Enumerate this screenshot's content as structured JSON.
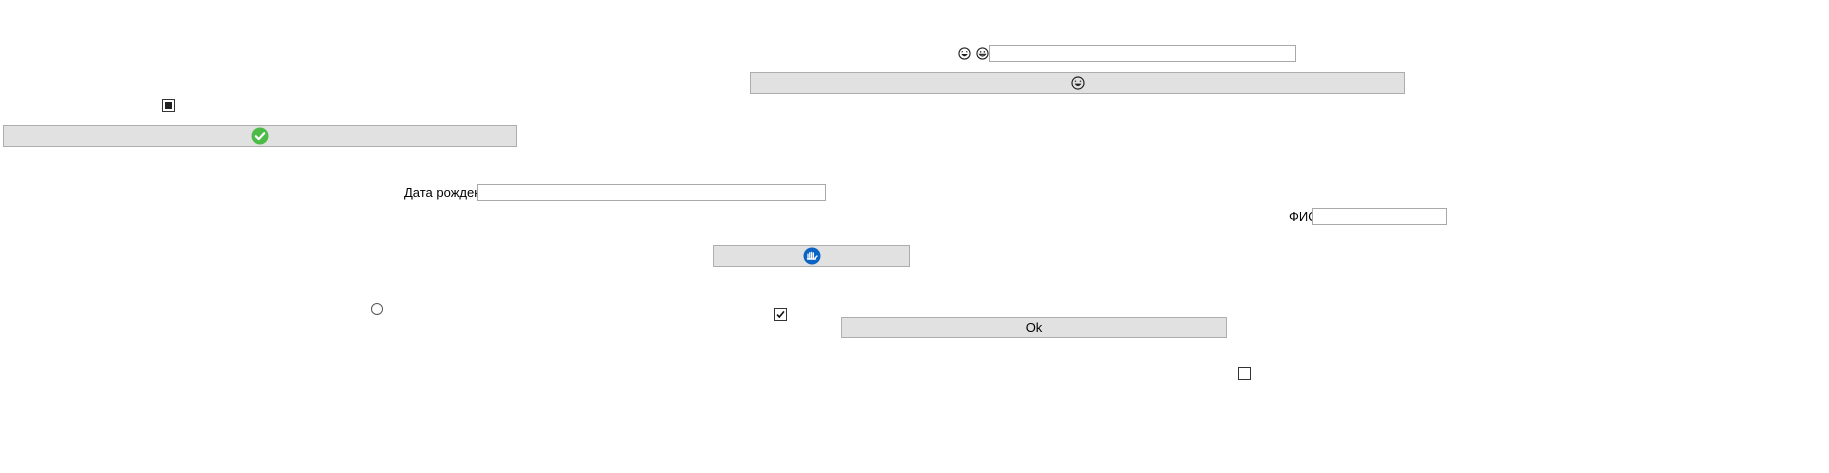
{
  "form": {
    "emoji_field": {
      "icons": [
        "laughing-face-icon",
        "grinning-face-icon"
      ],
      "value": ""
    },
    "emoji_button": {
      "icon": "laughing-face-icon",
      "label": ""
    },
    "square_checkbox": {
      "state": "indeterminate"
    },
    "check_button": {
      "icon": "green-checkmark-icon",
      "color": "#4cbb47",
      "label": ""
    },
    "birth_date": {
      "label": "Дата рождения",
      "value": ""
    },
    "full_name": {
      "label": "ФИО",
      "value": ""
    },
    "hand_button": {
      "icon": "blue-hand-icon",
      "color": "#0b63c4",
      "label": ""
    },
    "radio": {
      "checked": false
    },
    "checked_checkbox": {
      "checked": true
    },
    "ok_button": {
      "label": "Ok"
    },
    "empty_checkbox": {
      "checked": false
    }
  }
}
